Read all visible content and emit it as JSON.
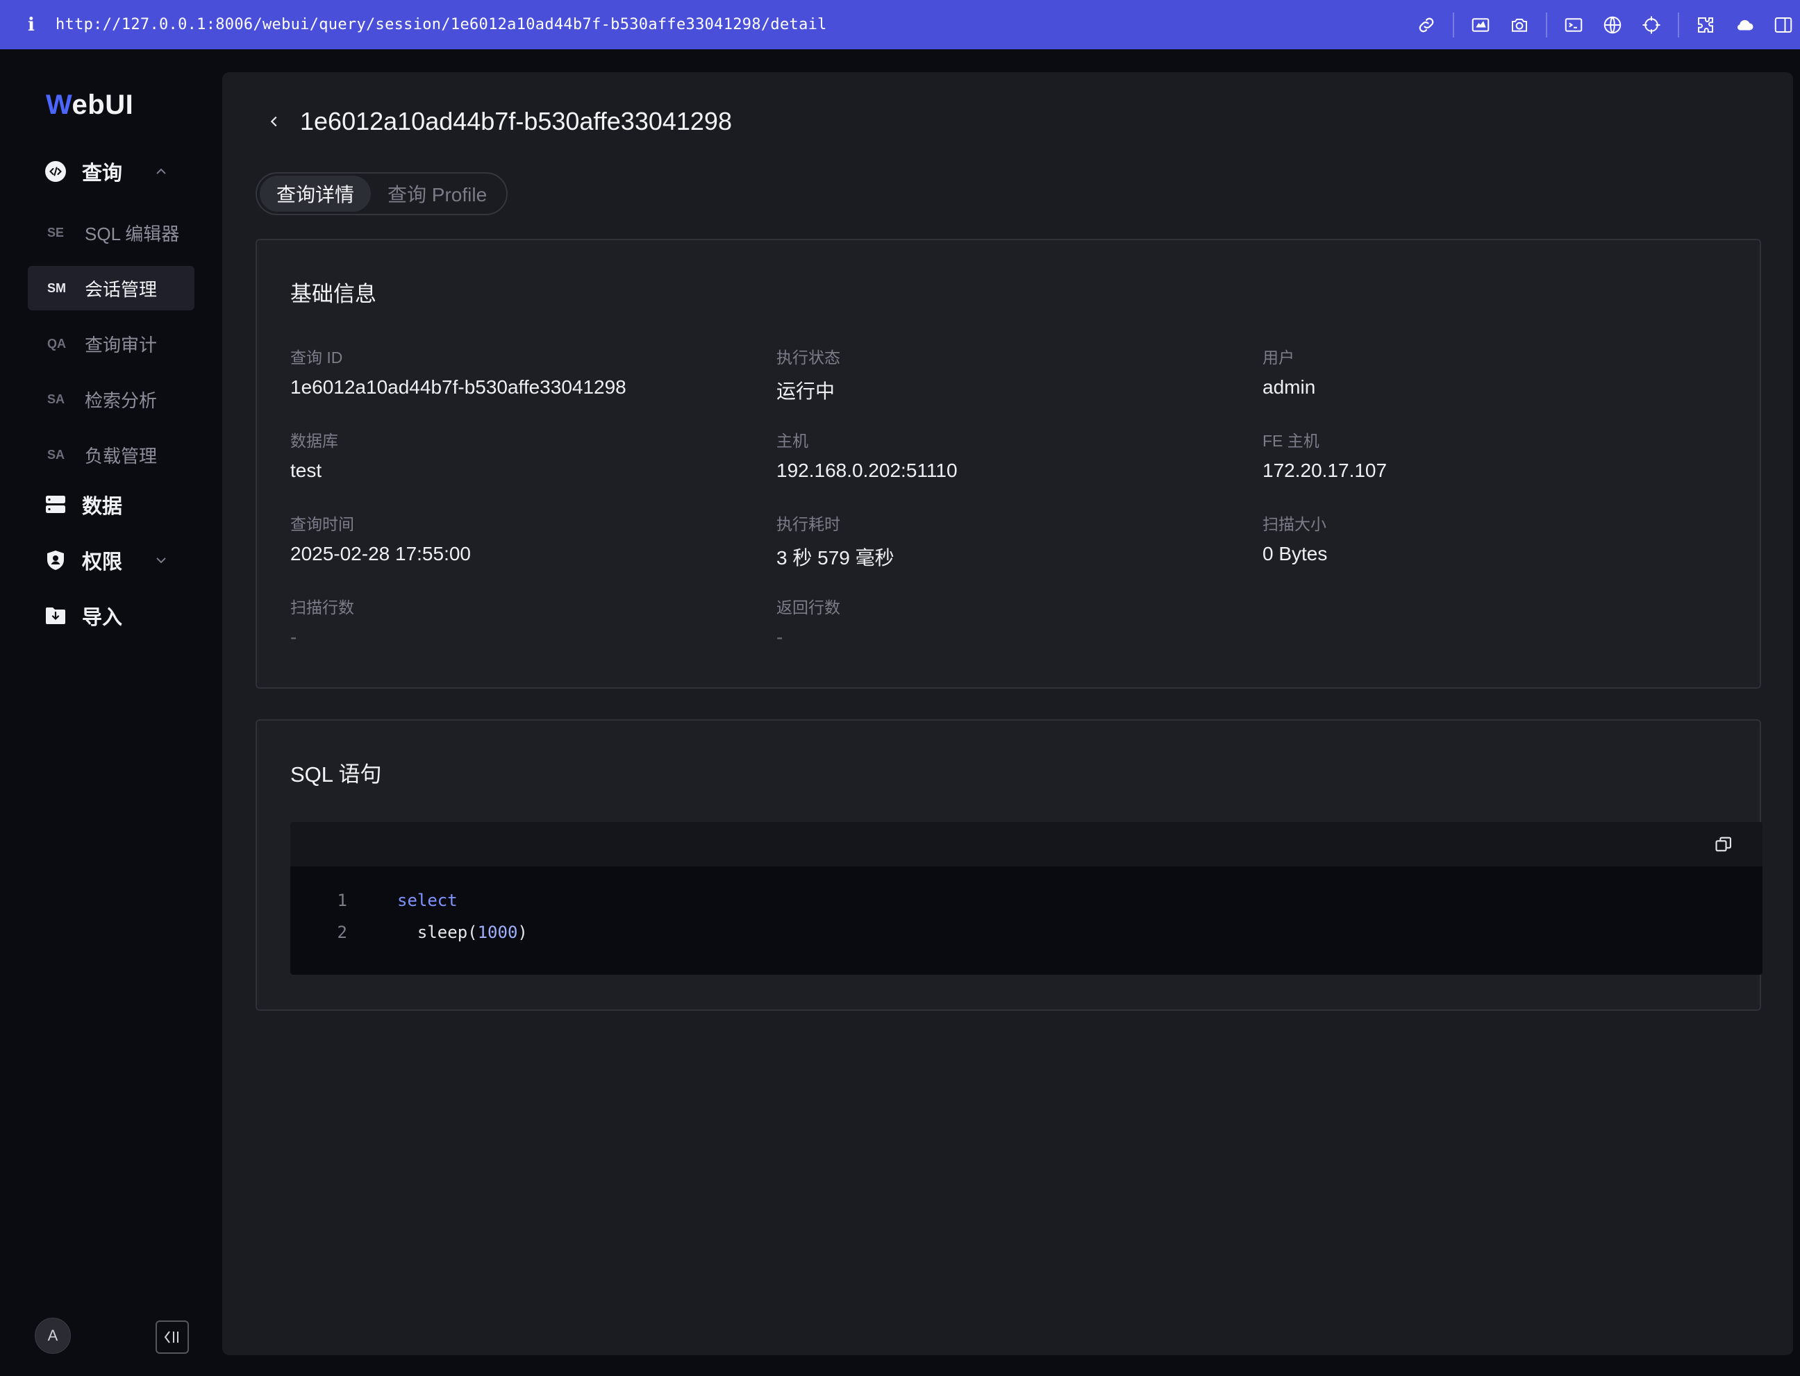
{
  "browser": {
    "url": "http://127.0.0.1:8006/webui/query/session/1e6012a10ad44b7f-b530affe33041298/detail",
    "accent": "#4a4fd9"
  },
  "app": {
    "logo_first": "W",
    "logo_rest": "ebUI"
  },
  "sidebar": {
    "groups": {
      "query": {
        "label": "查询",
        "icon": "code-bubble-icon",
        "expanded": true
      },
      "data": {
        "label": "数据",
        "icon": "database-icon"
      },
      "auth": {
        "label": "权限",
        "icon": "shield-user-icon",
        "expanded": false
      },
      "import": {
        "label": "导入",
        "icon": "folder-download-icon"
      }
    },
    "items": [
      {
        "abbr": "SE",
        "label": "SQL 编辑器"
      },
      {
        "abbr": "SM",
        "label": "会话管理",
        "active": true
      },
      {
        "abbr": "QA",
        "label": "查询审计"
      },
      {
        "abbr": "SA",
        "label": "检索分析"
      },
      {
        "abbr": "SA",
        "label": "负载管理"
      }
    ],
    "avatar_initial": "A"
  },
  "page": {
    "title": "1e6012a10ad44b7f-b530affe33041298",
    "tabs": [
      {
        "label": "查询详情",
        "active": true
      },
      {
        "label": "查询 Profile",
        "active": false
      }
    ]
  },
  "basic_info": {
    "title": "基础信息",
    "fields": [
      {
        "label": "查询 ID",
        "value": "1e6012a10ad44b7f-b530affe33041298"
      },
      {
        "label": "执行状态",
        "value": "运行中"
      },
      {
        "label": "用户",
        "value": "admin"
      },
      {
        "label": "数据库",
        "value": "test"
      },
      {
        "label": "主机",
        "value": "192.168.0.202:51110"
      },
      {
        "label": "FE 主机",
        "value": "172.20.17.107"
      },
      {
        "label": "查询时间",
        "value": "2025-02-28 17:55:00"
      },
      {
        "label": "执行耗时",
        "value": "3 秒 579 毫秒"
      },
      {
        "label": "扫描大小",
        "value": "0 Bytes"
      },
      {
        "label": "扫描行数",
        "value": "-"
      },
      {
        "label": "返回行数",
        "value": "-"
      }
    ]
  },
  "sql": {
    "title": "SQL 语句",
    "lines": [
      {
        "no": "1",
        "kw": "select",
        "pre": "",
        "num": "",
        "post": ""
      },
      {
        "no": "2",
        "kw": "",
        "pre": "  sleep(",
        "num": "1000",
        "post": ")"
      }
    ]
  }
}
